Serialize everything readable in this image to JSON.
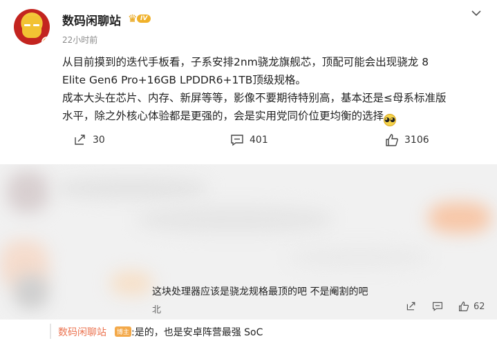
{
  "post": {
    "username": "数码闲聊站",
    "level": "IV",
    "time": "22小时前",
    "content_lines": [
      "从目前摸到的迭代手板看，子系安排2nm骁龙旗舰芯，顶配可能会出现骁龙 8",
      "Elite Gen6 Pro+16GB LPDDR6+1TB顶级规格。",
      "成本大头在芯片、内存、新屏等等，影像不要期待特别高，基本还是≤母系标准版",
      "水平，除之外核心体验都是更强的，会是实用党同价位更均衡的选择"
    ],
    "actions": {
      "repost_count": "30",
      "comment_count": "401",
      "like_count": "3106"
    }
  },
  "comment": {
    "text": "这块处理器应该是骁龙规格最顶的吧 不是阉割的吧",
    "location": "北",
    "like_count": "62"
  },
  "reply": {
    "name": "数码闲聊站",
    "tag": "博主",
    "text": ":是的，也是安卓阵营最强 SoC"
  },
  "colors": {
    "accent": "#eb7350",
    "gold": "#f0b12a",
    "muted": "#8a8a8a"
  }
}
